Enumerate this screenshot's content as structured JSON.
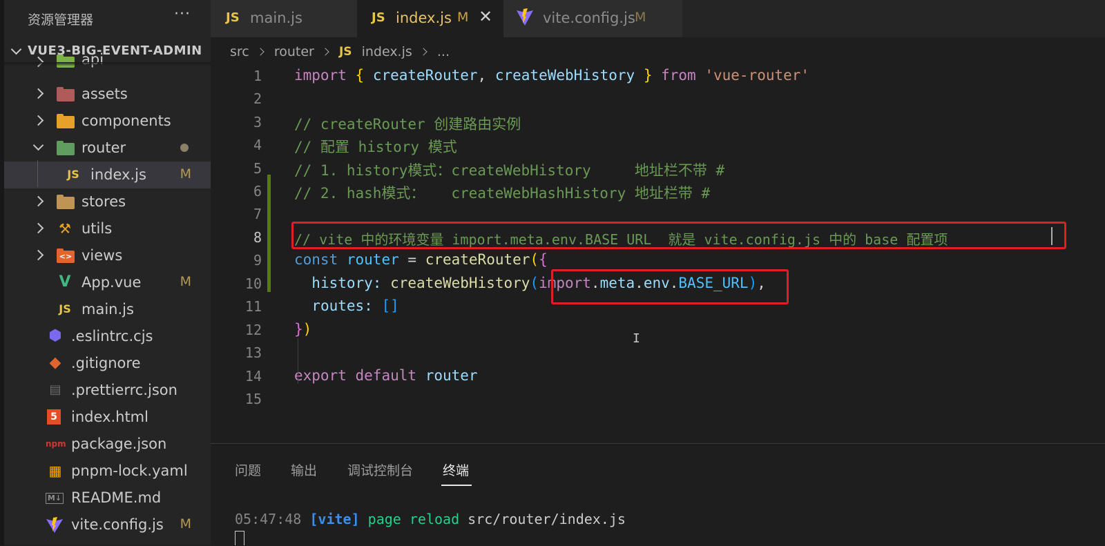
{
  "sidebar": {
    "title": "资源管理器",
    "more": "···",
    "section": "VUE3-BIG-EVENT-ADMIN",
    "items": [
      {
        "label": "api",
        "icon": "folder-api-icon"
      },
      {
        "label": "assets",
        "icon": "folder-assets-icon"
      },
      {
        "label": "components",
        "icon": "folder-components-icon"
      },
      {
        "label": "router",
        "icon": "folder-router-icon"
      },
      {
        "label": "index.js",
        "icon": "js-file-icon",
        "badge": "M"
      },
      {
        "label": "stores",
        "icon": "folder-icon"
      },
      {
        "label": "utils",
        "icon": "folder-utils-icon"
      },
      {
        "label": "views",
        "icon": "folder-views-icon"
      },
      {
        "label": "App.vue",
        "icon": "vue-file-icon",
        "badge": "M"
      },
      {
        "label": "main.js",
        "icon": "js-file-icon"
      },
      {
        "label": ".eslintrc.cjs",
        "icon": "eslint-icon"
      },
      {
        "label": ".gitignore",
        "icon": "git-icon"
      },
      {
        "label": ".prettierrc.json",
        "icon": "prettier-icon"
      },
      {
        "label": "index.html",
        "icon": "html5-icon"
      },
      {
        "label": "package.json",
        "icon": "npm-icon"
      },
      {
        "label": "pnpm-lock.yaml",
        "icon": "pnpm-icon"
      },
      {
        "label": "README.md",
        "icon": "markdown-icon"
      },
      {
        "label": "vite.config.js",
        "icon": "vite-icon",
        "badge": "M"
      }
    ]
  },
  "tabs": [
    {
      "icon_text": "JS",
      "label": "main.js",
      "badge": ""
    },
    {
      "icon_text": "JS",
      "label": "index.js",
      "badge": "M",
      "close": "✕"
    },
    {
      "icon_text": "",
      "label": "vite.config.js",
      "badge": "M"
    }
  ],
  "breadcrumb": {
    "parts": [
      "src",
      "router",
      "index.js",
      "..."
    ],
    "js": "JS"
  },
  "editor": {
    "line_numbers": [
      "1",
      "2",
      "3",
      "4",
      "5",
      "6",
      "7",
      "8",
      "9",
      "10",
      "11",
      "12",
      "13",
      "14",
      "15"
    ],
    "l1": {
      "import": "import",
      "open": "{",
      "a": "createRouter",
      "comma": ",",
      "b": "createWebHistory",
      "close": "}",
      "from": "from",
      "str": "'vue-router'"
    },
    "l3": "// createRouter 创建路由实例",
    "l4": "// 配置 history 模式",
    "l5": "// 1. history模式：createWebHistory     地址栏不带 #",
    "l6": "// 2. hash模式：   createWebHashHistory 地址栏带 #",
    "l8": "// vite 中的环境变量 import.meta.env.BASE_URL  就是 vite.config.js 中的 base 配置项",
    "l9": {
      "const": "const",
      "name": "router",
      "eq": "=",
      "fn": "createRouter",
      "paren": "(",
      "brace": "{"
    },
    "l10": {
      "key": "history:",
      "fn": "createWebHistory",
      "paren": "(",
      "imp": "import",
      "rest1": ".",
      "meta": "meta",
      "dot2": ".",
      "env": "env",
      "dot3": ".",
      "base": "BASE_URL",
      "close": ")",
      "comma": ","
    },
    "l11": {
      "key": "routes:",
      "arr": "[]"
    },
    "l12": {
      "brace": "}",
      "paren": ")"
    },
    "l14": {
      "export": "export",
      "default": "default",
      "name": "router"
    }
  },
  "panel": {
    "tabs": [
      "问题",
      "输出",
      "调试控制台",
      "终端"
    ],
    "terminal": {
      "time": "05:47:48",
      "tag": "[vite]",
      "msg": "page reload",
      "path": "src/router/index.js"
    }
  }
}
